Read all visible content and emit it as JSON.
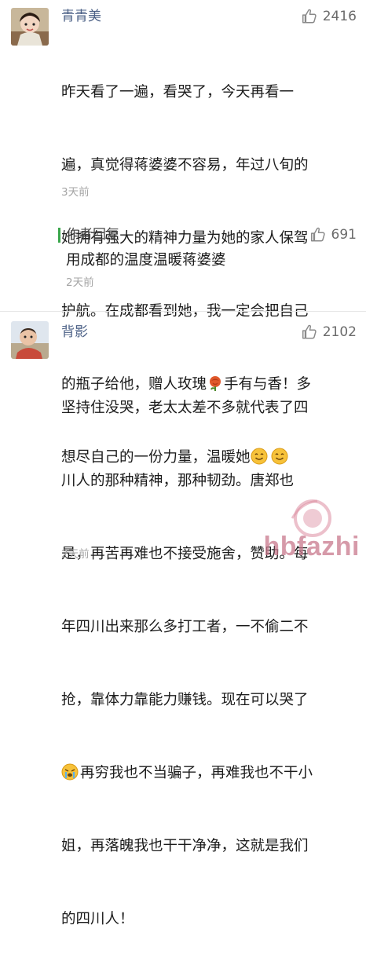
{
  "comments": [
    {
      "username": "青青美",
      "likes": "2416",
      "text_lines": [
        "昨天看了一遍，看哭了，今天再看一",
        "遍，真觉得蒋婆婆不容易，年过八旬的",
        "她拥有强大的精神力量为她的家人保驾",
        "护航。在成都看到她，我一定会把自己",
        "的瓶子给他，赠人玫瑰",
        "手有与香！多",
        "想尽自己的一份力量，温暖她"
      ],
      "time": "3天前",
      "reply": {
        "label": "作者回复",
        "likes": "691",
        "text": "用成都的温度温暖蒋婆婆",
        "time": "2天前"
      }
    },
    {
      "username": "背影",
      "likes": "2102",
      "text_lines": [
        "坚持住没哭，老太太差不多就代表了四",
        "川人的那种精神，那种韧劲。唐郑也",
        "是，再苦再难也不接受施舍，赞助。每",
        "年四川出来那么多打工者，一不偷二不",
        "抢，靠体力靠能力赚钱。现在可以哭了",
        "再穷我也不当骗子，再难我也不干小",
        "姐，再落魄我也干干净净，这就是我们",
        "的四川人！"
      ],
      "time": "2天前"
    }
  ],
  "icons": {
    "like": "thumbs-up-icon",
    "rose": "rose-emoji-icon",
    "smile": "smile-emoji-icon",
    "cry": "crying-emoji-icon"
  },
  "colors": {
    "username": "#4a5f85",
    "reply_bar": "#3aa64b",
    "time": "#a5a5a5"
  },
  "watermark": "hbfazhi"
}
